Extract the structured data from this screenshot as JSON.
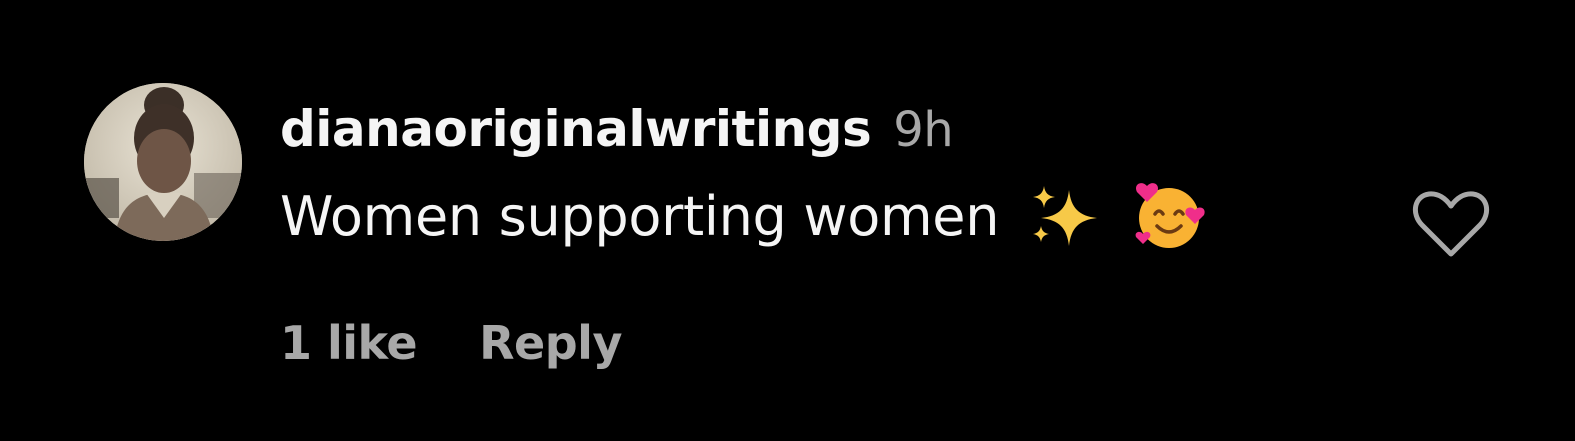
{
  "comment": {
    "username": "dianaoriginalwritings",
    "timestamp": "9h",
    "text": "Women supporting women",
    "emojis": [
      "sparkles-icon",
      "smiling-face-with-hearts-icon"
    ],
    "likes_label": "1 like",
    "reply_label": "Reply",
    "like_icon": "heart-outline-icon"
  },
  "colors": {
    "background": "#000000",
    "primary_text": "#f5f5f5",
    "secondary_text": "#a8a8a8",
    "sparkles": "#f7c948",
    "face": "#f9b233",
    "hearts": "#f02e8a"
  }
}
